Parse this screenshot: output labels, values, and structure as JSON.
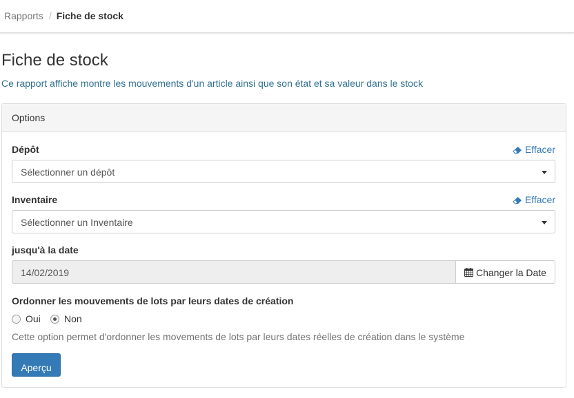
{
  "breadcrumb": {
    "parent": "Rapports",
    "separator": "/",
    "current": "Fiche de stock"
  },
  "page": {
    "title": "Fiche de stock",
    "description": "Ce rapport affiche montre les mouvements d'un article ainsi que son état et sa valeur dans le stock"
  },
  "panel": {
    "title": "Options"
  },
  "depot": {
    "label": "Dépôt",
    "clear_label": "Effacer",
    "placeholder": "Sélectionner un dépôt"
  },
  "inventaire": {
    "label": "Inventaire",
    "clear_label": "Effacer",
    "placeholder": "Sélectionner un Inventaire"
  },
  "date": {
    "label": "jusqu'à la date",
    "value": "14/02/2019",
    "button_label": "Changer la Date"
  },
  "order": {
    "label": "Ordonner les mouvements de lots par leurs dates de création",
    "options": [
      "Oui",
      "Non"
    ],
    "selected": "Non",
    "help": "Cette option permet d'ordonner les movements de lots par leurs dates réelles de création dans le système"
  },
  "actions": {
    "preview_label": "Aperçu"
  },
  "colors": {
    "primary": "#337ab7",
    "link": "#337ab7",
    "info_text": "#31708f",
    "panel_heading_bg": "#f5f5f5",
    "readonly_bg": "#eeeeee"
  },
  "icons": {
    "clear": "eraser-icon",
    "calendar": "calendar-icon",
    "dropdown": "caret-down-icon"
  }
}
